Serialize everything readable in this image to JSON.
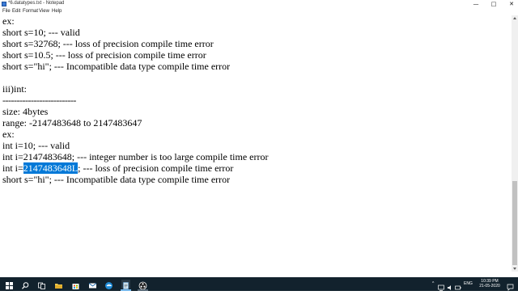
{
  "window": {
    "title": "*6.datatypes.txt - Notepad",
    "minimize_glyph": "—",
    "maximize_glyph": "□",
    "close_glyph": "✕"
  },
  "menu": [
    "File",
    "Edit",
    "Format",
    "View",
    "Help"
  ],
  "lines": [
    "ex:",
    "short s=10; --- valid",
    "short s=32768; --- loss of precision compile time error",
    "short s=10.5; --- loss of precision compile time error",
    "short s=\"hi\"; --- Incompatible data type compile time error",
    "",
    "iii)int:",
    "--------------------------",
    "size: 4bytes",
    "range: -2147483648 to 2147483647",
    "ex:",
    "int i=10; --- valid",
    "int i=2147483648; --- integer number is too large compile time error",
    "short s=\"hi\"; --- Incompatible data type compile time error"
  ],
  "selected_line": {
    "prefix": "int i=",
    "selected": "2147483648L",
    "suffix": "; --- loss of precision compile time error"
  },
  "taskbar": {
    "tray_arrow": "^",
    "language": "ENG",
    "time": "10:39 PM",
    "date": "21-05-2020",
    "icons": [
      "windows-logo-icon",
      "search-icon",
      "task-view-icon",
      "explorer-icon",
      "store-icon",
      "mail-icon",
      "edge-icon",
      "notepad-icon",
      "obs-icon"
    ]
  },
  "colors": {
    "selection": "#0078d7",
    "taskbar": "#12222d",
    "active_indicator": "#76b9ed"
  }
}
